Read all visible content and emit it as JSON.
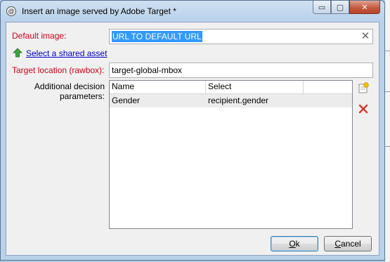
{
  "window": {
    "title": "Insert an image served by Adobe Target *",
    "app_icon_glyph": "@",
    "minimize_glyph": "▭",
    "maximize_glyph": "▢",
    "close_glyph": "✕"
  },
  "form": {
    "default_image_label": "Default image:",
    "default_image_value": "URL TO DEFAULT URL",
    "clear_glyph": "✕",
    "shared_asset_link": "Select a shared asset",
    "target_location_label": "Target location (rawbox):",
    "target_location_value": "target-global-mbox",
    "decision_params_label_line1": "Additional decision",
    "decision_params_label_line2": "parameters:"
  },
  "grid": {
    "columns": [
      "Name",
      "Select"
    ],
    "rows": [
      {
        "name": "Gender",
        "select": "recipient.gender"
      }
    ]
  },
  "side_actions": {
    "add_icon": "add-row-icon",
    "delete_icon": "delete-row-icon"
  },
  "buttons": {
    "ok_label": "Ok",
    "ok_mnemonic_rest": "k",
    "ok_mnemonic": "O",
    "cancel_label": "Cancel",
    "cancel_mnemonic": "C",
    "cancel_mnemonic_rest": "ancel"
  },
  "colors": {
    "required_label": "#d0021b",
    "selection": "#3399ff",
    "link": "#0000cc"
  }
}
